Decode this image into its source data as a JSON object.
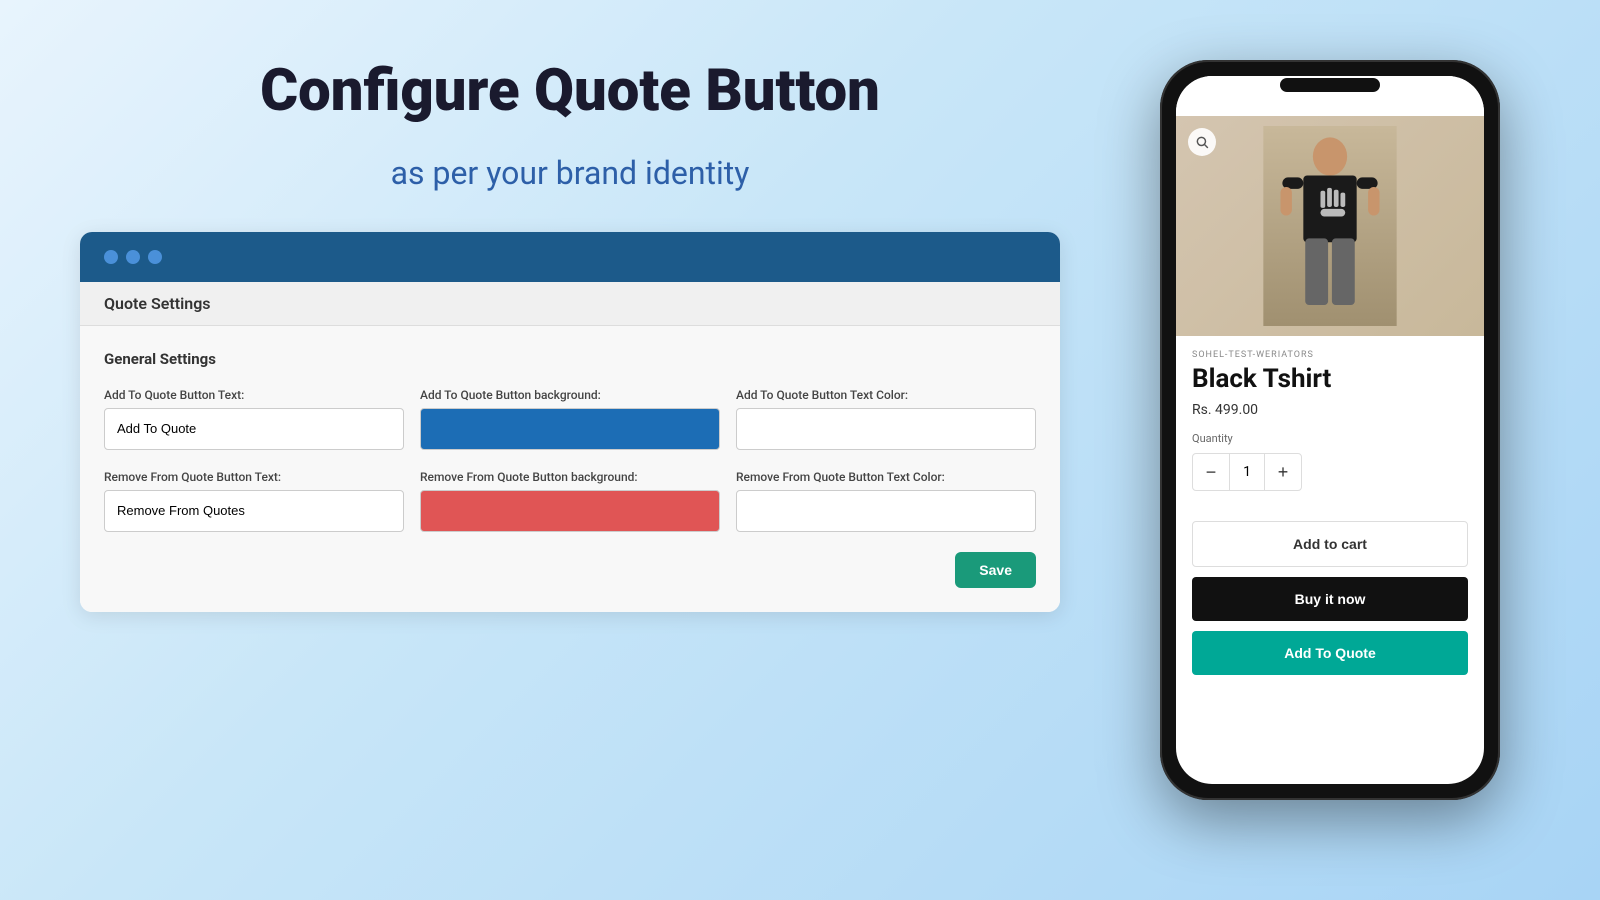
{
  "hero": {
    "title": "Configure Quote Button",
    "subtitle": "as per your brand identity"
  },
  "settings": {
    "card_nav_title": "Quote Settings",
    "general_title": "General Settings",
    "add_quote": {
      "text_label": "Add To Quote Button Text:",
      "text_value": "Add To Quote",
      "bg_label": "Add To Quote Button background:",
      "bg_color": "#1c6db5",
      "text_color_label": "Add To Quote Button Text Color:",
      "text_color": "#ffffff"
    },
    "remove_quote": {
      "text_label": "Remove From Quote Button Text:",
      "text_value": "Remove From Quotes",
      "bg_label": "Remove From Quote Button background:",
      "bg_color": "#e05555",
      "text_color_label": "Remove From Quote Button Text Color:",
      "text_color": "#ffffff"
    },
    "save_btn": "Save"
  },
  "phone": {
    "store_name": "SOHEL-TEST-WERIATORS",
    "product_name": "Black Tshirt",
    "price": "Rs. 499.00",
    "quantity_label": "Quantity",
    "quantity_value": "1",
    "btn_add_cart": "Add to cart",
    "btn_buy_now": "Buy it now",
    "btn_add_quote": "Add To Quote",
    "qty_minus": "−",
    "qty_plus": "+"
  }
}
